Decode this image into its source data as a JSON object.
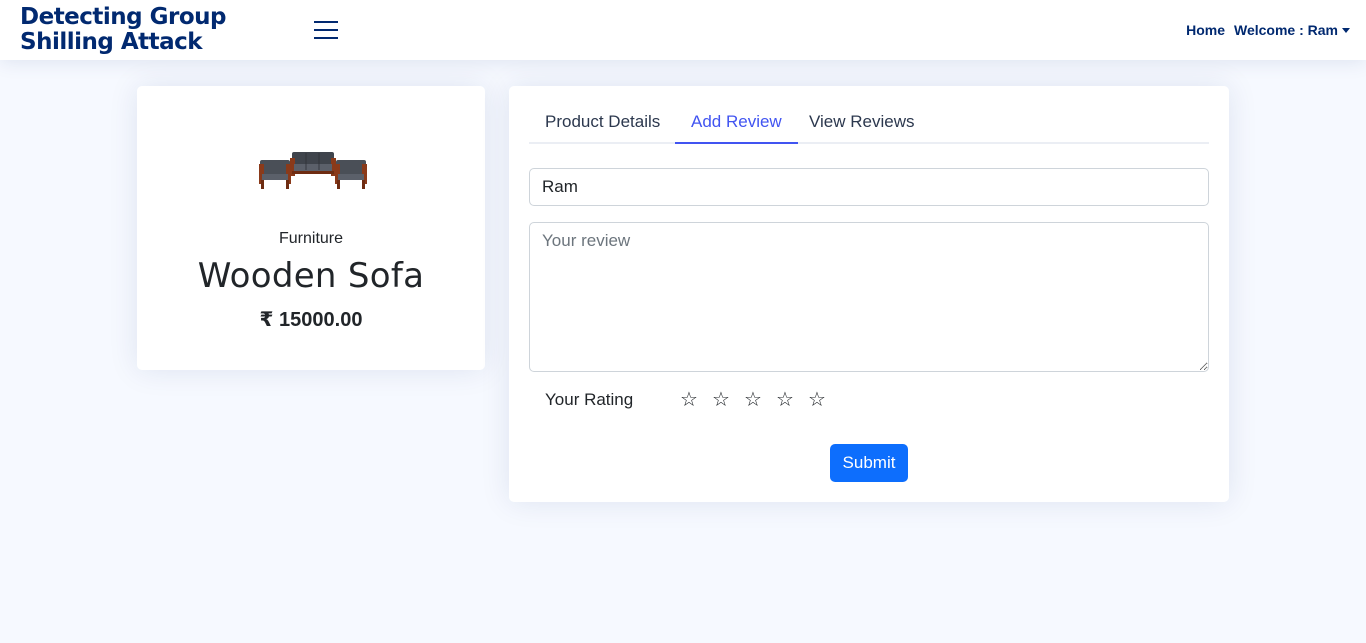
{
  "header": {
    "logo_line1": "Detecting Group",
    "logo_line2": "Shilling Attack",
    "nav_home": "Home",
    "nav_welcome": "Welcome : Ram"
  },
  "product": {
    "category": "Furniture",
    "name": "Wooden Sofa",
    "price": "₹ 15000.00",
    "image_icon": "sofa-image"
  },
  "tabs": [
    {
      "label": "Product Details",
      "active": false
    },
    {
      "label": "Add Review",
      "active": true
    },
    {
      "label": "View Reviews",
      "active": false
    }
  ],
  "form": {
    "name_value": "Ram",
    "review_placeholder": "Your review",
    "rating_label": "Your Rating",
    "rating_value": 0,
    "rating_max": 5,
    "submit_label": "Submit"
  },
  "colors": {
    "brand": "#012970",
    "accent": "#4154f1",
    "primary_button": "#0d6efd",
    "background": "#f6f9ff"
  }
}
